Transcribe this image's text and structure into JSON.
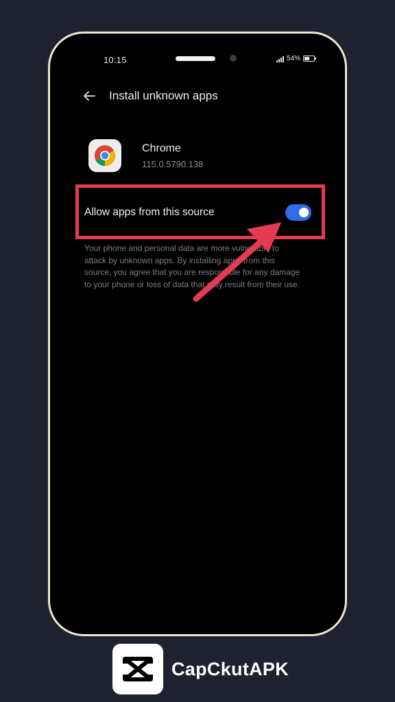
{
  "status_bar": {
    "time": "10:15",
    "battery": "54%",
    "battery_level": 0.54
  },
  "app_bar": {
    "back_icon": "arrow-left-icon",
    "title": "Install unknown apps"
  },
  "app": {
    "icon": "chrome-icon",
    "name": "Chrome",
    "version": "115.0.5790.138"
  },
  "setting": {
    "label": "Allow apps from this source",
    "enabled": true,
    "toggle_color": "#2f6de4"
  },
  "description": "Your phone and personal data are more vulnerable to attack by unknown apps. By installing apps from this source, you agree that you are responsible for any damage to your phone or loss of data that may result from their use.",
  "annotation": {
    "highlight_color": "#e23b52",
    "arrow_icon": "red-arrow-icon"
  },
  "branding": {
    "logo_icon": "capcut-logo-icon",
    "name": "CapCkutAPK"
  }
}
